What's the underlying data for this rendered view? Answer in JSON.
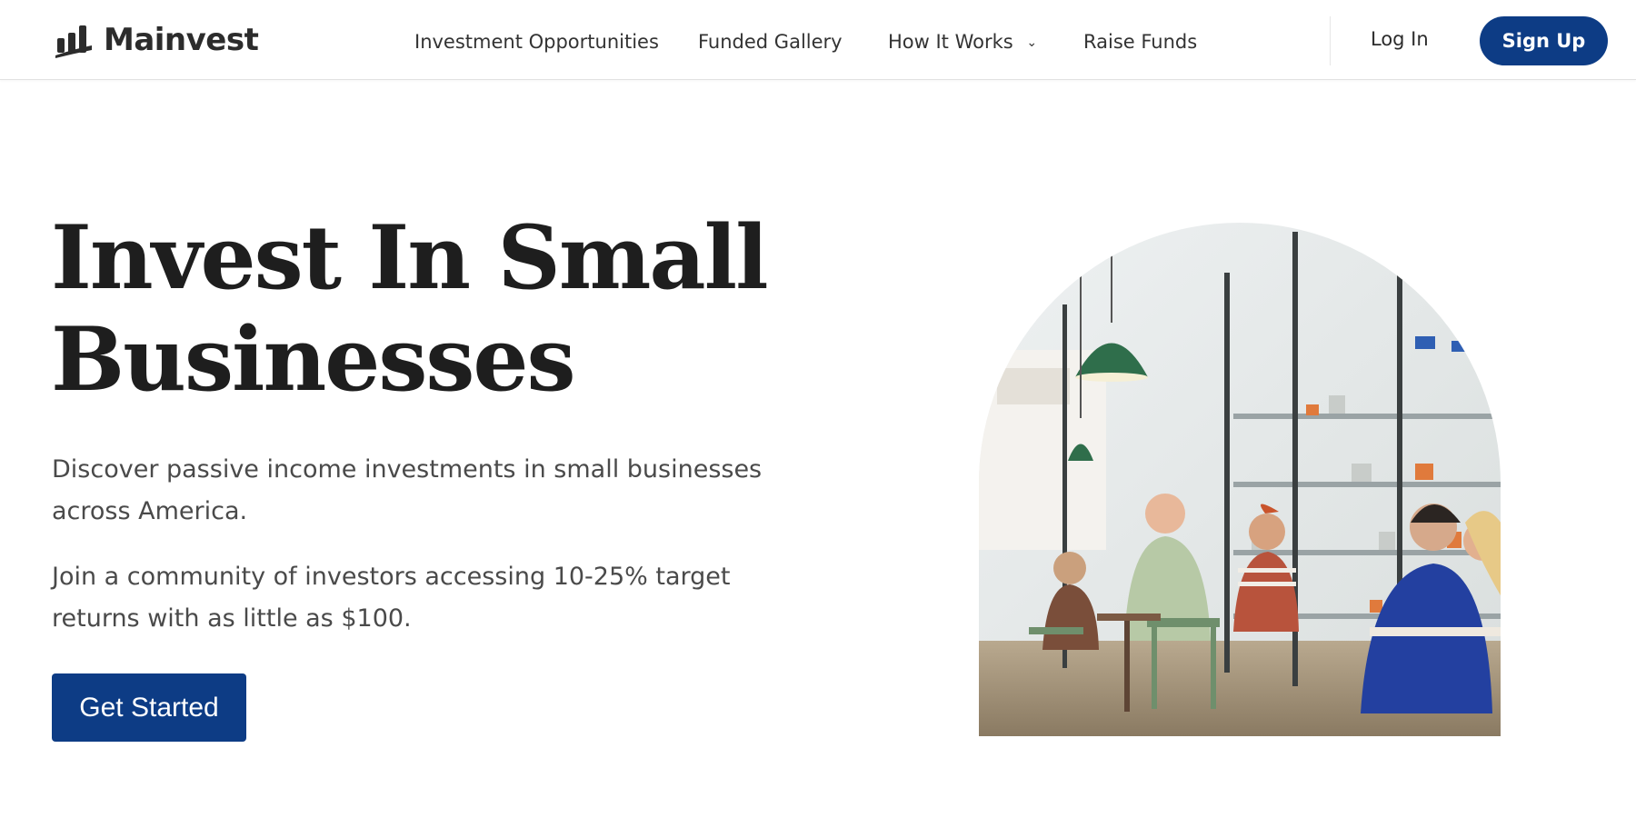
{
  "brand": {
    "name": "Mainvest",
    "logo_icon": "bar-chart-logo-icon",
    "accent_color": "#0d3c85"
  },
  "nav": {
    "items": [
      {
        "label": "Investment Opportunities"
      },
      {
        "label": "Funded Gallery"
      },
      {
        "label": "How It Works",
        "icon": "chevron-down-icon"
      },
      {
        "label": "Raise Funds"
      }
    ],
    "login_label": "Log In",
    "signup_label": "Sign Up"
  },
  "hero": {
    "title_line1": "Invest In Small",
    "title_line2": "Businesses",
    "paragraph1": "Discover passive income investments in small businesses across America.",
    "paragraph2": "Join a community of investors accessing 10-25% target returns with as little as $100.",
    "cta_label": "Get Started",
    "image_subject": "cafe-interior-photo"
  }
}
